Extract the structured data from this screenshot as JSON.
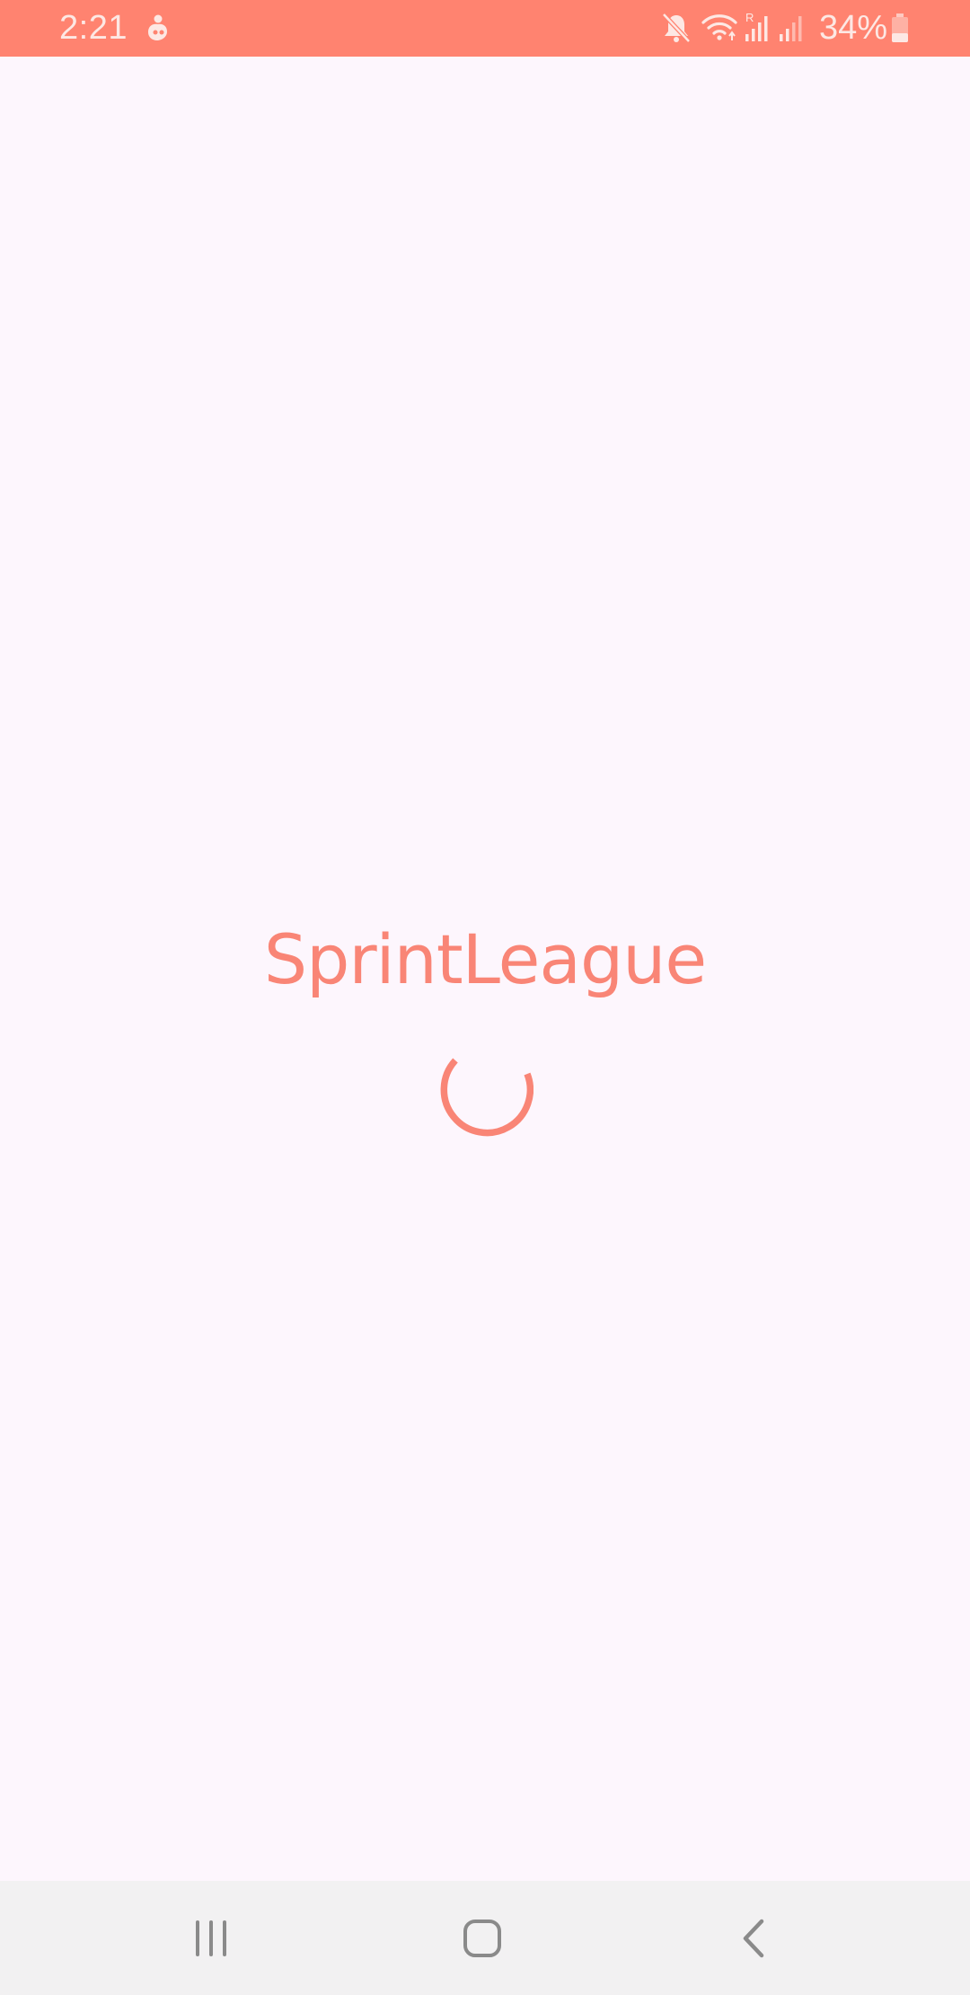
{
  "status_bar": {
    "time": "2:21",
    "battery_percent": "34%",
    "icons": [
      "notification-app-icon",
      "mute-icon",
      "wifi-icon",
      "signal-roaming-icon",
      "signal-icon",
      "battery-icon"
    ],
    "background_color": "#ff8370"
  },
  "splash": {
    "app_name": "SprintLeague",
    "brand_color": "#f98576",
    "background_color": "#fdf6fd",
    "loading_indicator": "spinner-icon"
  },
  "navigation_bar": {
    "buttons": [
      "recents-icon",
      "home-icon",
      "back-icon"
    ]
  }
}
